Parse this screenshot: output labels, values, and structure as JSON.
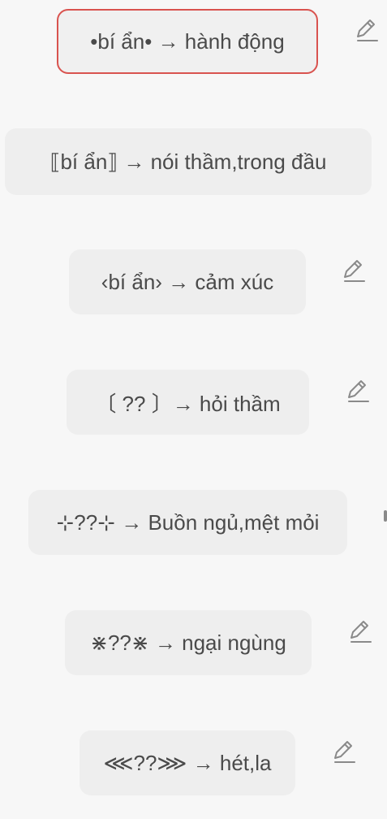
{
  "items": [
    {
      "text": "•bí ẩn• → hành động",
      "selected": true
    },
    {
      "text": "⟦bí ẩn⟧  → nói thầm,trong đầu",
      "selected": false
    },
    {
      "text": "‹bí ẩn› → cảm xúc",
      "selected": false
    },
    {
      "text": "〔 ?? 〕→ hỏi thầm",
      "selected": false
    },
    {
      "text": "⊹??⊹ → Buồn ngủ,mệt mỏi",
      "selected": false
    },
    {
      "text": "⋇??⋇ → ngại ngùng",
      "selected": false
    },
    {
      "text": "⋘??⋙ → hét,la",
      "selected": false
    }
  ],
  "icons": {
    "edit": "pencil-icon"
  },
  "colors": {
    "background": "#f7f7f7",
    "chip": "#eeeeee",
    "selected_border": "#d9534f",
    "text": "#4a4a4a",
    "icon": "#8a8a8a"
  }
}
